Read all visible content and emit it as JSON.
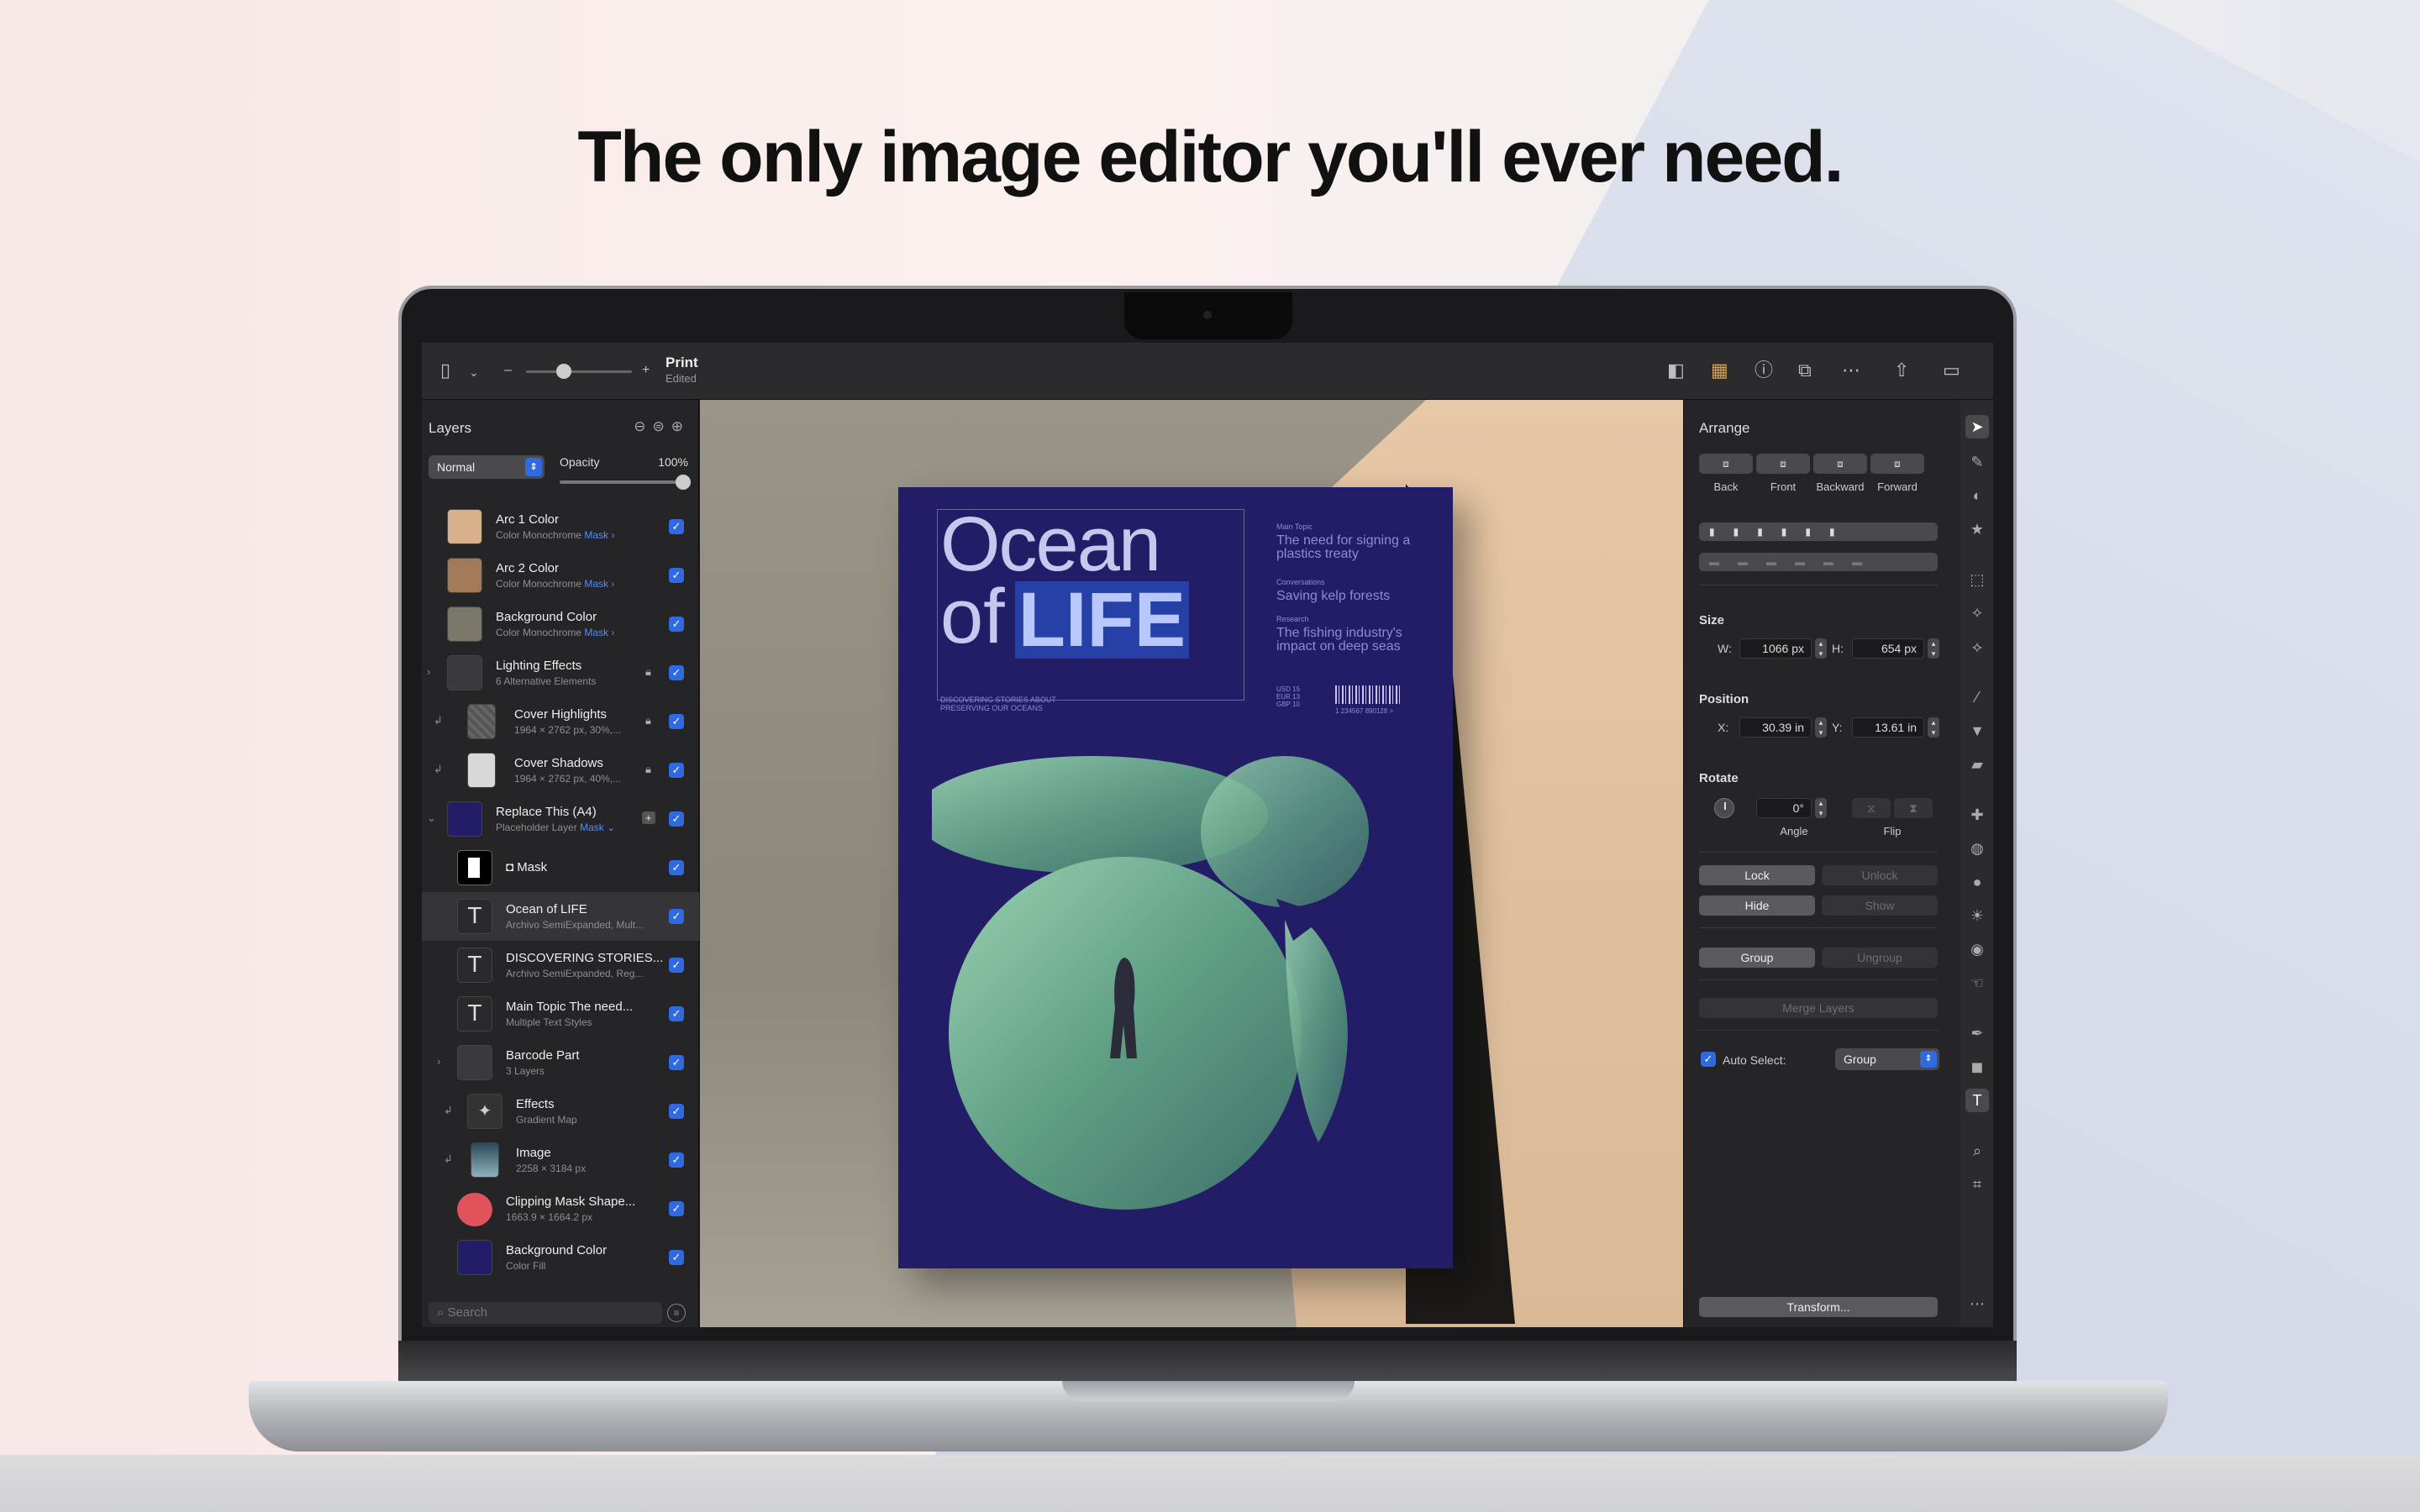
{
  "headline": "The only image editor you'll ever need.",
  "toolbar": {
    "doc_title": "Print",
    "doc_status": "Edited",
    "zoom_minus": "–",
    "zoom_plus": "+"
  },
  "layers_panel": {
    "title": "Layers",
    "blend_mode": "Normal",
    "opacity_label": "Opacity",
    "opacity_value": "100%",
    "search_placeholder": "Search",
    "rows": [
      {
        "name": "Arc 1 Color",
        "sub": "Color Monochrome",
        "mask": "Mask ›"
      },
      {
        "name": "Arc 2 Color",
        "sub": "Color Monochrome",
        "mask": "Mask ›"
      },
      {
        "name": "Background Color",
        "sub": "Color Monochrome",
        "mask": "Mask ›"
      },
      {
        "name": "Lighting Effects",
        "sub": "6 Alternative Elements",
        "mask": ""
      },
      {
        "name": "Cover Highlights",
        "sub": "1964 × 2762 px, 30%,...",
        "mask": ""
      },
      {
        "name": "Cover Shadows",
        "sub": "1964 × 2762 px, 40%,...",
        "mask": ""
      },
      {
        "name": "Replace This (A4)",
        "sub": "Placeholder Layer",
        "mask": "Mask ⌄"
      },
      {
        "name": "◘ Mask",
        "sub": "",
        "mask": ""
      },
      {
        "name": "Ocean of LIFE",
        "sub": "Archivo SemiExpanded, Mult...",
        "mask": ""
      },
      {
        "name": "DISCOVERING STORIES...",
        "sub": "Archivo SemiExpanded, Reg...",
        "mask": ""
      },
      {
        "name": "Main Topic The need...",
        "sub": "Multiple Text Styles",
        "mask": ""
      },
      {
        "name": "Barcode Part",
        "sub": "3 Layers",
        "mask": ""
      },
      {
        "name": "Effects",
        "sub": "Gradient Map",
        "mask": ""
      },
      {
        "name": "Image",
        "sub": "2258 × 3184 px",
        "mask": ""
      },
      {
        "name": "Clipping Mask Shape...",
        "sub": "1663.9 × 1664.2 px",
        "mask": ""
      },
      {
        "name": "Background Color",
        "sub": "Color Fill",
        "mask": ""
      }
    ]
  },
  "cover": {
    "title_line1": "Ocean",
    "title_of": "of",
    "title_life": "LIFE",
    "main_topic_label": "Main Topic",
    "main_topic": "The need for signing a plastics treaty",
    "conversations_label": "Conversations",
    "conversations": "Saving kelp forests",
    "research_label": "Research",
    "research": "The fishing industry's impact on deep seas",
    "tagline": "DISCOVERING STORIES ABOUT PRESERVING OUR OCEANS",
    "prices": "USD 15 EUR 13 GBP 10",
    "barcode_digits": "1 234567 890128 >"
  },
  "arrange": {
    "title": "Arrange",
    "order_buttons": [
      "Back",
      "Front",
      "Backward",
      "Forward"
    ],
    "size_label": "Size",
    "w_label": "W:",
    "w_value": "1066 px",
    "h_label": "H:",
    "h_value": "654 px",
    "position_label": "Position",
    "x_label": "X:",
    "x_value": "30.39 in",
    "y_label": "Y:",
    "y_value": "13.61 in",
    "rotate_label": "Rotate",
    "angle_value": "0°",
    "angle_label": "Angle",
    "flip_label": "Flip",
    "lock": "Lock",
    "unlock": "Unlock",
    "hide": "Hide",
    "show": "Show",
    "group": "Group",
    "ungroup": "Ungroup",
    "merge": "Merge Layers",
    "auto_select_label": "Auto Select:",
    "auto_select_value": "Group",
    "transform": "Transform..."
  },
  "colors": {
    "accent": "#2f6ae0",
    "cover": "#231d67",
    "art_green": "#6fb08c"
  }
}
